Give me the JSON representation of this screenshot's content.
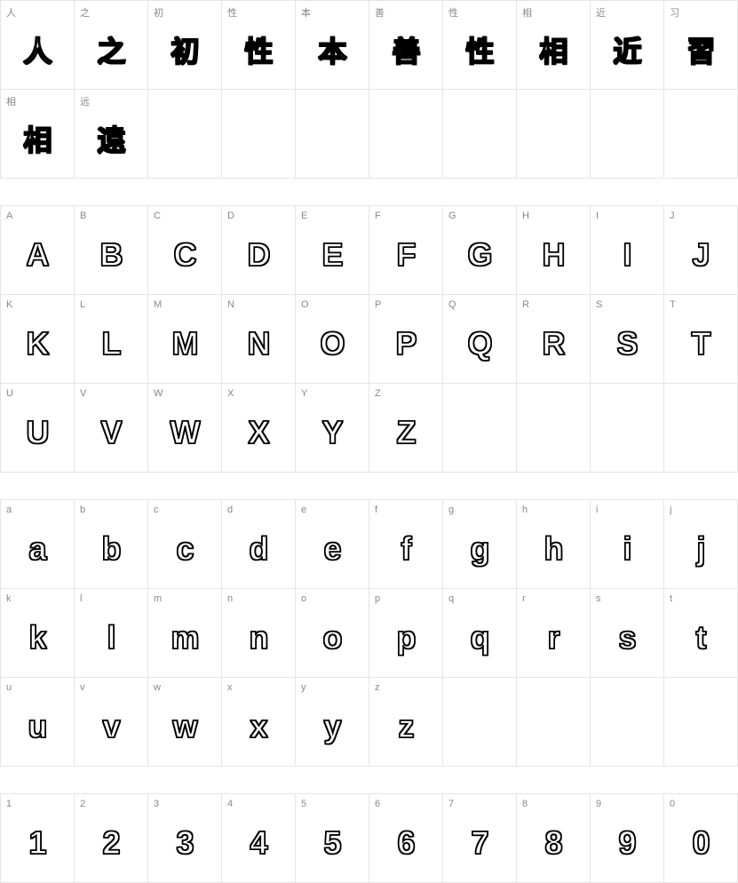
{
  "sections": [
    {
      "id": "chinese",
      "rows": [
        [
          {
            "label": "人",
            "glyph": "人"
          },
          {
            "label": "之",
            "glyph": "之"
          },
          {
            "label": "初",
            "glyph": "初"
          },
          {
            "label": "性",
            "glyph": "性"
          },
          {
            "label": "本",
            "glyph": "本"
          },
          {
            "label": "善",
            "glyph": "善"
          },
          {
            "label": "性",
            "glyph": "性"
          },
          {
            "label": "相",
            "glyph": "相"
          },
          {
            "label": "近",
            "glyph": "近"
          },
          {
            "label": "习",
            "glyph": "習"
          }
        ],
        [
          {
            "label": "相",
            "glyph": "相"
          },
          {
            "label": "远",
            "glyph": "遠"
          },
          {
            "label": "",
            "glyph": ""
          },
          {
            "label": "",
            "glyph": ""
          },
          {
            "label": "",
            "glyph": ""
          },
          {
            "label": "",
            "glyph": ""
          },
          {
            "label": "",
            "glyph": ""
          },
          {
            "label": "",
            "glyph": ""
          },
          {
            "label": "",
            "glyph": ""
          },
          {
            "label": "",
            "glyph": ""
          }
        ]
      ]
    },
    {
      "id": "uppercase",
      "rows": [
        [
          {
            "label": "A",
            "glyph": "A"
          },
          {
            "label": "B",
            "glyph": "B"
          },
          {
            "label": "C",
            "glyph": "C"
          },
          {
            "label": "D",
            "glyph": "D"
          },
          {
            "label": "E",
            "glyph": "E"
          },
          {
            "label": "F",
            "glyph": "F"
          },
          {
            "label": "G",
            "glyph": "G"
          },
          {
            "label": "H",
            "glyph": "H"
          },
          {
            "label": "I",
            "glyph": "I"
          },
          {
            "label": "J",
            "glyph": "J"
          }
        ],
        [
          {
            "label": "K",
            "glyph": "K"
          },
          {
            "label": "L",
            "glyph": "L"
          },
          {
            "label": "M",
            "glyph": "M"
          },
          {
            "label": "N",
            "glyph": "N"
          },
          {
            "label": "O",
            "glyph": "O"
          },
          {
            "label": "P",
            "glyph": "P"
          },
          {
            "label": "Q",
            "glyph": "Q"
          },
          {
            "label": "R",
            "glyph": "R"
          },
          {
            "label": "S",
            "glyph": "S"
          },
          {
            "label": "T",
            "glyph": "T"
          }
        ],
        [
          {
            "label": "U",
            "glyph": "U"
          },
          {
            "label": "V",
            "glyph": "V"
          },
          {
            "label": "W",
            "glyph": "W"
          },
          {
            "label": "X",
            "glyph": "X"
          },
          {
            "label": "Y",
            "glyph": "Y"
          },
          {
            "label": "Z",
            "glyph": "Z"
          },
          {
            "label": "",
            "glyph": ""
          },
          {
            "label": "",
            "glyph": ""
          },
          {
            "label": "",
            "glyph": ""
          },
          {
            "label": "",
            "glyph": ""
          }
        ]
      ]
    },
    {
      "id": "lowercase",
      "rows": [
        [
          {
            "label": "a",
            "glyph": "a"
          },
          {
            "label": "b",
            "glyph": "b"
          },
          {
            "label": "c",
            "glyph": "c"
          },
          {
            "label": "d",
            "glyph": "d"
          },
          {
            "label": "e",
            "glyph": "e"
          },
          {
            "label": "f",
            "glyph": "f"
          },
          {
            "label": "g",
            "glyph": "g"
          },
          {
            "label": "h",
            "glyph": "h"
          },
          {
            "label": "i",
            "glyph": "i"
          },
          {
            "label": "j",
            "glyph": "j"
          }
        ],
        [
          {
            "label": "k",
            "glyph": "k"
          },
          {
            "label": "l",
            "glyph": "l"
          },
          {
            "label": "m",
            "glyph": "m"
          },
          {
            "label": "n",
            "glyph": "n"
          },
          {
            "label": "o",
            "glyph": "o"
          },
          {
            "label": "p",
            "glyph": "p"
          },
          {
            "label": "q",
            "glyph": "q"
          },
          {
            "label": "r",
            "glyph": "r"
          },
          {
            "label": "s",
            "glyph": "s"
          },
          {
            "label": "t",
            "glyph": "t"
          }
        ],
        [
          {
            "label": "u",
            "glyph": "u"
          },
          {
            "label": "v",
            "glyph": "v"
          },
          {
            "label": "w",
            "glyph": "w"
          },
          {
            "label": "x",
            "glyph": "x"
          },
          {
            "label": "y",
            "glyph": "y"
          },
          {
            "label": "z",
            "glyph": "z"
          },
          {
            "label": "",
            "glyph": ""
          },
          {
            "label": "",
            "glyph": ""
          },
          {
            "label": "",
            "glyph": ""
          },
          {
            "label": "",
            "glyph": ""
          }
        ]
      ]
    },
    {
      "id": "digits",
      "rows": [
        [
          {
            "label": "1",
            "glyph": "1"
          },
          {
            "label": "2",
            "glyph": "2"
          },
          {
            "label": "3",
            "glyph": "3"
          },
          {
            "label": "4",
            "glyph": "4"
          },
          {
            "label": "5",
            "glyph": "5"
          },
          {
            "label": "6",
            "glyph": "6"
          },
          {
            "label": "7",
            "glyph": "7"
          },
          {
            "label": "8",
            "glyph": "8"
          },
          {
            "label": "9",
            "glyph": "9"
          },
          {
            "label": "0",
            "glyph": "0"
          }
        ]
      ]
    }
  ]
}
